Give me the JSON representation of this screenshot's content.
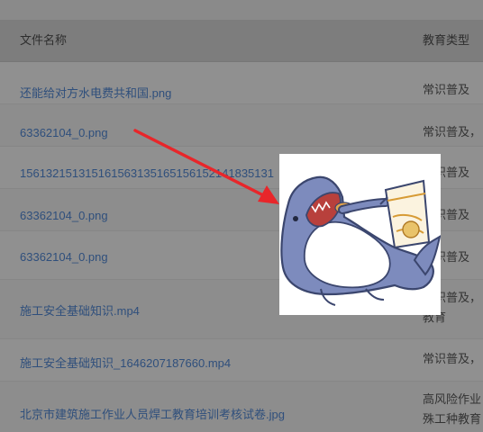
{
  "table": {
    "headers": {
      "name": "文件名称",
      "type": "教育类型"
    },
    "rows": [
      {
        "name": "还能给对方水电费共和国.png",
        "type": [
          "常识普及"
        ]
      },
      {
        "name": "63362104_0.png",
        "type": [
          "常识普及，"
        ]
      },
      {
        "name": "156132151315161563135165156152141835131",
        "type": [
          "常识普及"
        ]
      },
      {
        "name": "63362104_0.png",
        "type": [
          "常识普及"
        ]
      },
      {
        "name": "63362104_0.png",
        "type": [
          "常识普及"
        ]
      },
      {
        "name": "施工安全基础知识.mp4",
        "type": [
          "常识普及，",
          "教育"
        ]
      },
      {
        "name": "施工安全基础知识_1646207187660.mp4",
        "type": [
          "常识普及，"
        ]
      },
      {
        "name": "北京市建筑施工作业人员焊工教育培训考核试卷.jpg",
        "type": [
          "高风险作业",
          "殊工种教育"
        ]
      }
    ]
  },
  "colors": {
    "overlay": "#8e8e8e",
    "link": "#2f4f7c",
    "arrow": "#e8262a",
    "shark_body": "#7d8bbd"
  },
  "sticker": {
    "icon": "shark-eating-chips-sticker"
  },
  "annotation": {
    "icon": "red-arrow-icon"
  }
}
